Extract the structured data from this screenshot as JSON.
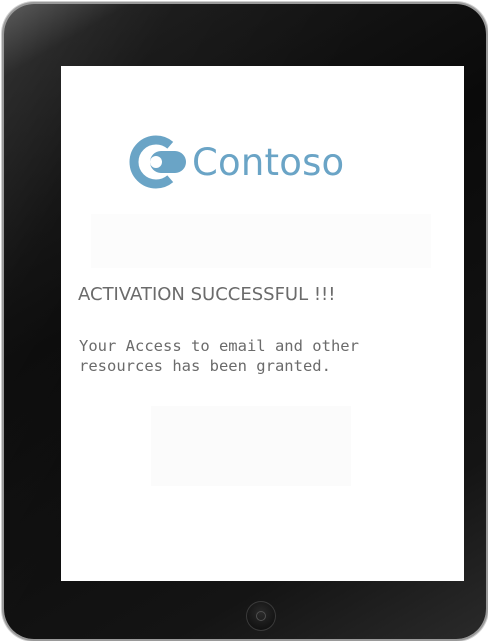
{
  "brand": {
    "name": "Contoso",
    "color": "#6aa4c6",
    "logo_icon": "contoso-c-logo-icon"
  },
  "status": {
    "title": "ACTIVATION SUCCESSFUL !!!",
    "message_lines": [
      "Your Access to email and other",
      "resources has been granted."
    ]
  },
  "device": {
    "home_button_icon": "home-button-icon"
  }
}
